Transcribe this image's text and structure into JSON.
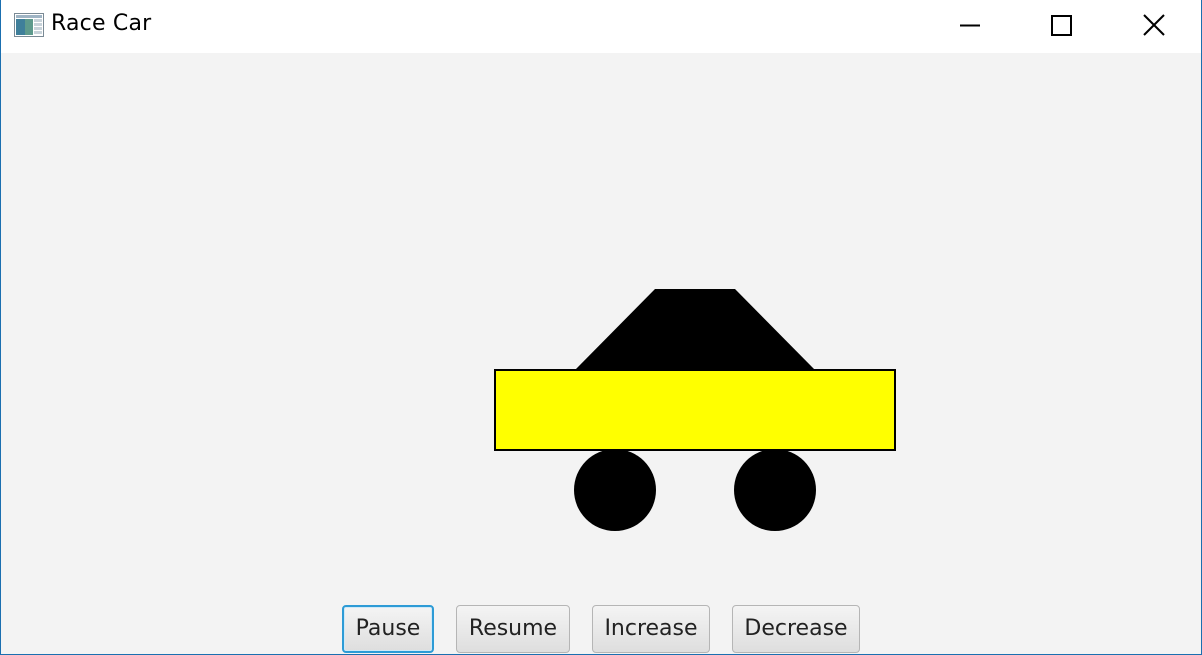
{
  "window": {
    "title": "Race Car"
  },
  "title_controls": {
    "minimize_icon": "minimize-icon",
    "maximize_icon": "maximize-icon",
    "close_icon": "close-icon"
  },
  "car": {
    "body_color": "#ffff00",
    "roof_color": "#000000",
    "wheel_color": "#000000"
  },
  "buttons": {
    "pause": "Pause",
    "resume": "Resume",
    "increase": "Increase",
    "decrease": "Decrease"
  },
  "colors": {
    "focus_ring": "#2d9bd6",
    "window_border": "#1a6fb0",
    "background": "#f3f3f3"
  }
}
